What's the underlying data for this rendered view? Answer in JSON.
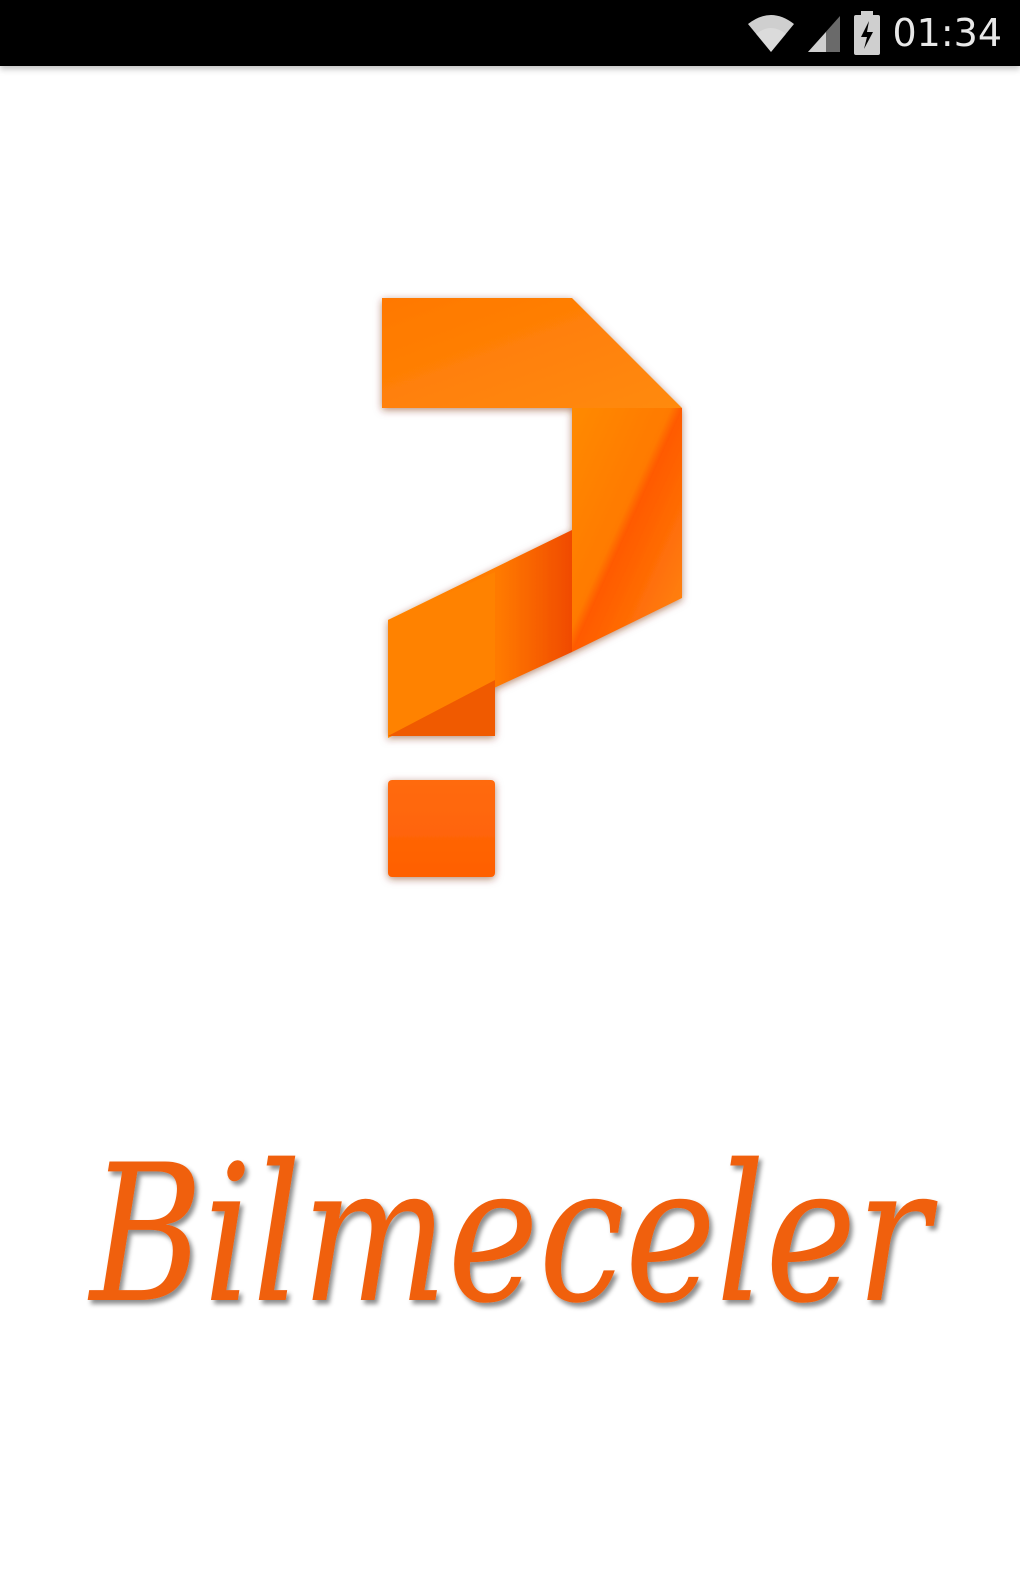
{
  "status_bar": {
    "time": "01:34",
    "icons": [
      "wifi-icon",
      "cell-signal-icon",
      "battery-icon"
    ]
  },
  "splash": {
    "logo_icon": "question-mark-icon",
    "app_name": "Bilmeceler"
  },
  "colors": {
    "accent": "#ff7a00",
    "accent_dark": "#e85a00",
    "wordmark": "#f06010",
    "status_bar_bg": "#000000",
    "background": "#ffffff"
  }
}
